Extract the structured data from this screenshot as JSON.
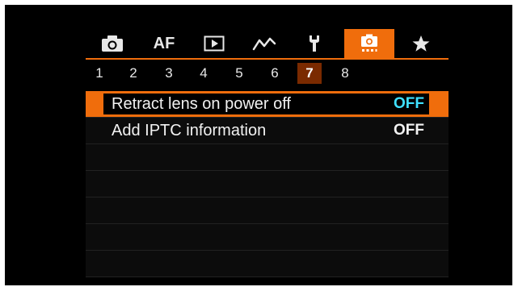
{
  "tabs": [
    {
      "icon": "camera-icon",
      "active": false
    },
    {
      "label": "AF",
      "active": false
    },
    {
      "icon": "playback-icon",
      "active": false
    },
    {
      "icon": "wireless-icon",
      "active": false
    },
    {
      "icon": "wrench-icon",
      "active": false
    },
    {
      "icon": "shooting-custom-icon",
      "active": true
    },
    {
      "icon": "star-icon",
      "active": false
    }
  ],
  "pages": [
    "1",
    "2",
    "3",
    "4",
    "5",
    "6",
    "7",
    "8"
  ],
  "active_page": "7",
  "menu": {
    "items": [
      {
        "label": "Retract lens on power off",
        "value": "OFF",
        "selected": true
      },
      {
        "label": "Add IPTC information",
        "value": "OFF",
        "selected": false
      }
    ]
  },
  "colors": {
    "accent": "#f06d0c",
    "selected_value": "#3fe0ff",
    "active_page_bg": "#7a2a00"
  }
}
